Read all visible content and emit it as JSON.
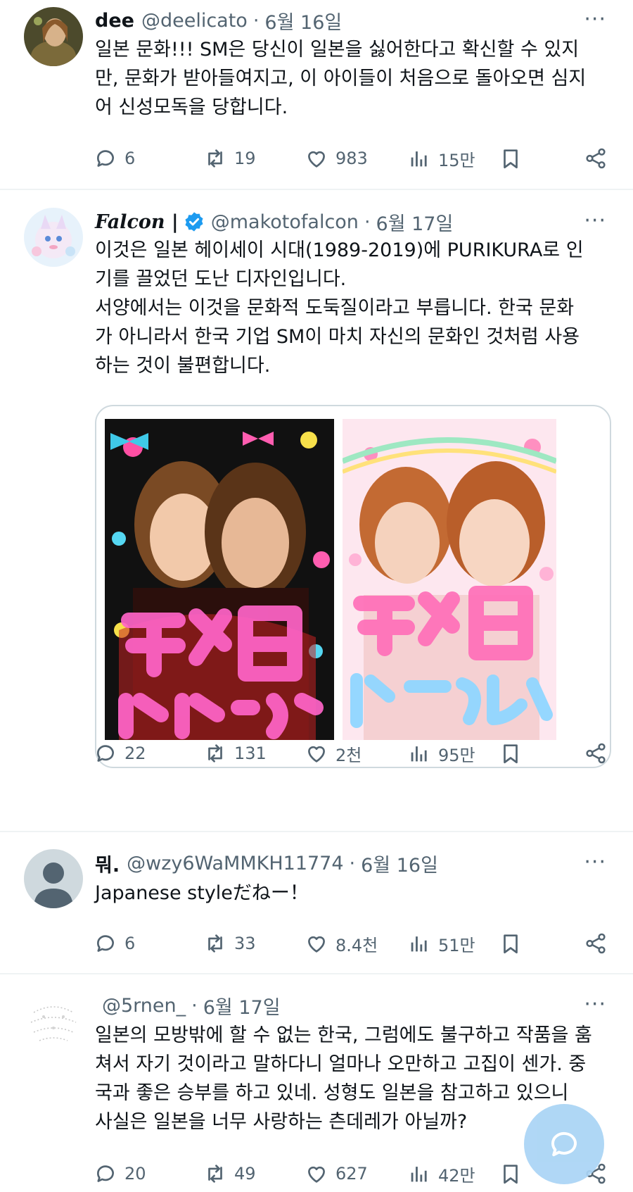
{
  "colors": {
    "text_primary": "#0f1419",
    "text_secondary": "#536471",
    "divider": "#eff3f4",
    "verified_blue": "#1d9bf0",
    "fab": "#a9d4f5"
  },
  "tweets": [
    {
      "display_name": "dee",
      "handle": "@deelicato",
      "separator": "·",
      "date": "6월 16일",
      "more_label": "···",
      "text_lines": [
        "일본 문화!!! SM은 당신이 일본을 싫어한다고 확신할 수 있지",
        "만, 문화가 받아들여지고, 이 아이들이 처음으로 돌아오면 심지",
        "어 신성모독을 당합니다."
      ],
      "replies": "6",
      "reposts": "19",
      "likes": "983",
      "views": "15만"
    },
    {
      "display_name": "Falcon |",
      "verified": true,
      "handle": "@makotofalcon",
      "separator": "·",
      "date": "6월 17일",
      "more_label": "···",
      "text_lines": [
        "이것은 일본 헤이세이 시대(1989-2019)에 PURIKURA로 인",
        "기를 끌었던 도난 디자인입니다.",
        "서양에서는 이것을 문화적 도둑질이라고 부릅니다. 한국 문화",
        "가 아니라서 한국 기업 SM이 마치 자신의 문화인 것처럼 사용",
        "하는 것이 불편합니다."
      ],
      "media": {
        "left_photo_caption": "デカ目 ビビッド",
        "right_photo_caption": "デカ目 パステル"
      },
      "replies": "22",
      "reposts": "131",
      "likes": "2천",
      "views": "95만"
    },
    {
      "display_name": "뭐.",
      "handle": "@wzy6WaMMKH11774",
      "separator": "·",
      "date": "6월 16일",
      "more_label": "···",
      "text_lines": [
        "Japanese styleだねー！"
      ],
      "replies": "6",
      "reposts": "33",
      "likes": "8.4천",
      "views": "51만"
    },
    {
      "display_name": "",
      "handle": "@5rnen_",
      "separator": "·",
      "date": "6월 17일",
      "more_label": "···",
      "text_lines": [
        "일본의 모방밖에 할 수 없는 한국, 그럼에도 불구하고 작품을 훔",
        "쳐서 자기 것이라고 말하다니 얼마나 오만하고 고집이 센가. 중",
        "국과 좋은 승부를 하고 있네.  성형도 일본을 참고하고 있으니",
        "사실은 일본을 너무 사랑하는 츤데레가 아닐까?"
      ],
      "replies": "20",
      "reposts": "49",
      "likes": "627",
      "views": "42만"
    }
  ],
  "icons": {
    "reply": "speech-bubble-icon",
    "repost": "repost-arrows-icon",
    "like": "heart-icon",
    "views": "bar-chart-icon",
    "bookmark": "bookmark-icon",
    "share": "share-nodes-icon",
    "verified": "verified-badge-icon",
    "compose": "new-message-icon"
  }
}
